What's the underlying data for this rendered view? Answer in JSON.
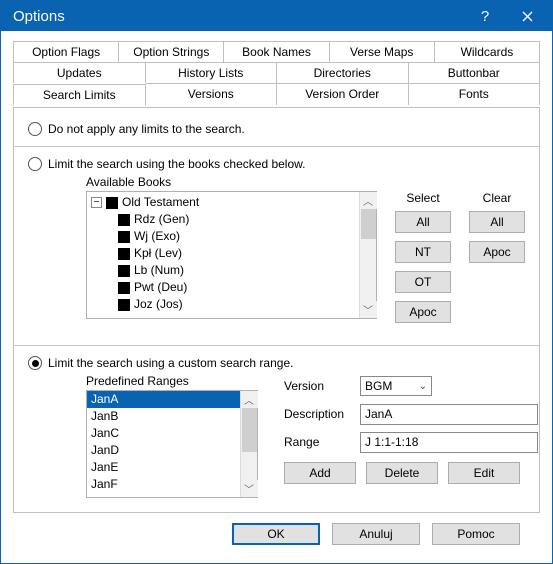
{
  "window": {
    "title": "Options"
  },
  "tabs": {
    "row1": [
      "Option Flags",
      "Option Strings",
      "Book Names",
      "Verse Maps",
      "Wildcards"
    ],
    "row2": [
      "Updates",
      "History Lists",
      "Directories",
      "Buttonbar"
    ],
    "row3": [
      "Search Limits",
      "Versions",
      "Version Order",
      "Fonts"
    ],
    "active": "Search Limits"
  },
  "options": {
    "opt_none": "Do not apply any limits to the search.",
    "opt_books": "Limit the search using the books checked below.",
    "opt_custom": "Limit the search using a custom search range."
  },
  "books": {
    "label": "Available Books",
    "root": "Old Testament",
    "items": [
      "Rdz (Gen)",
      "Wj (Exo)",
      "Kpł (Lev)",
      "Lb (Num)",
      "Pwt (Deu)",
      "Joz (Jos)"
    ]
  },
  "side": {
    "select": "Select",
    "clear": "Clear",
    "all": "All",
    "nt": "NT",
    "ot": "OT",
    "apoc": "Apoc"
  },
  "custom": {
    "predef_label": "Predefined Ranges",
    "ranges": [
      "JanA",
      "JanB",
      "JanC",
      "JanD",
      "JanE",
      "JanF"
    ],
    "version_label": "Version",
    "version_value": "BGM",
    "desc_label": "Description",
    "desc_value": "JanA",
    "range_label": "Range",
    "range_value": "J 1:1-1:18",
    "add": "Add",
    "delete": "Delete",
    "edit": "Edit"
  },
  "footer": {
    "ok": "OK",
    "cancel": "Anuluj",
    "help": "Pomoc"
  }
}
